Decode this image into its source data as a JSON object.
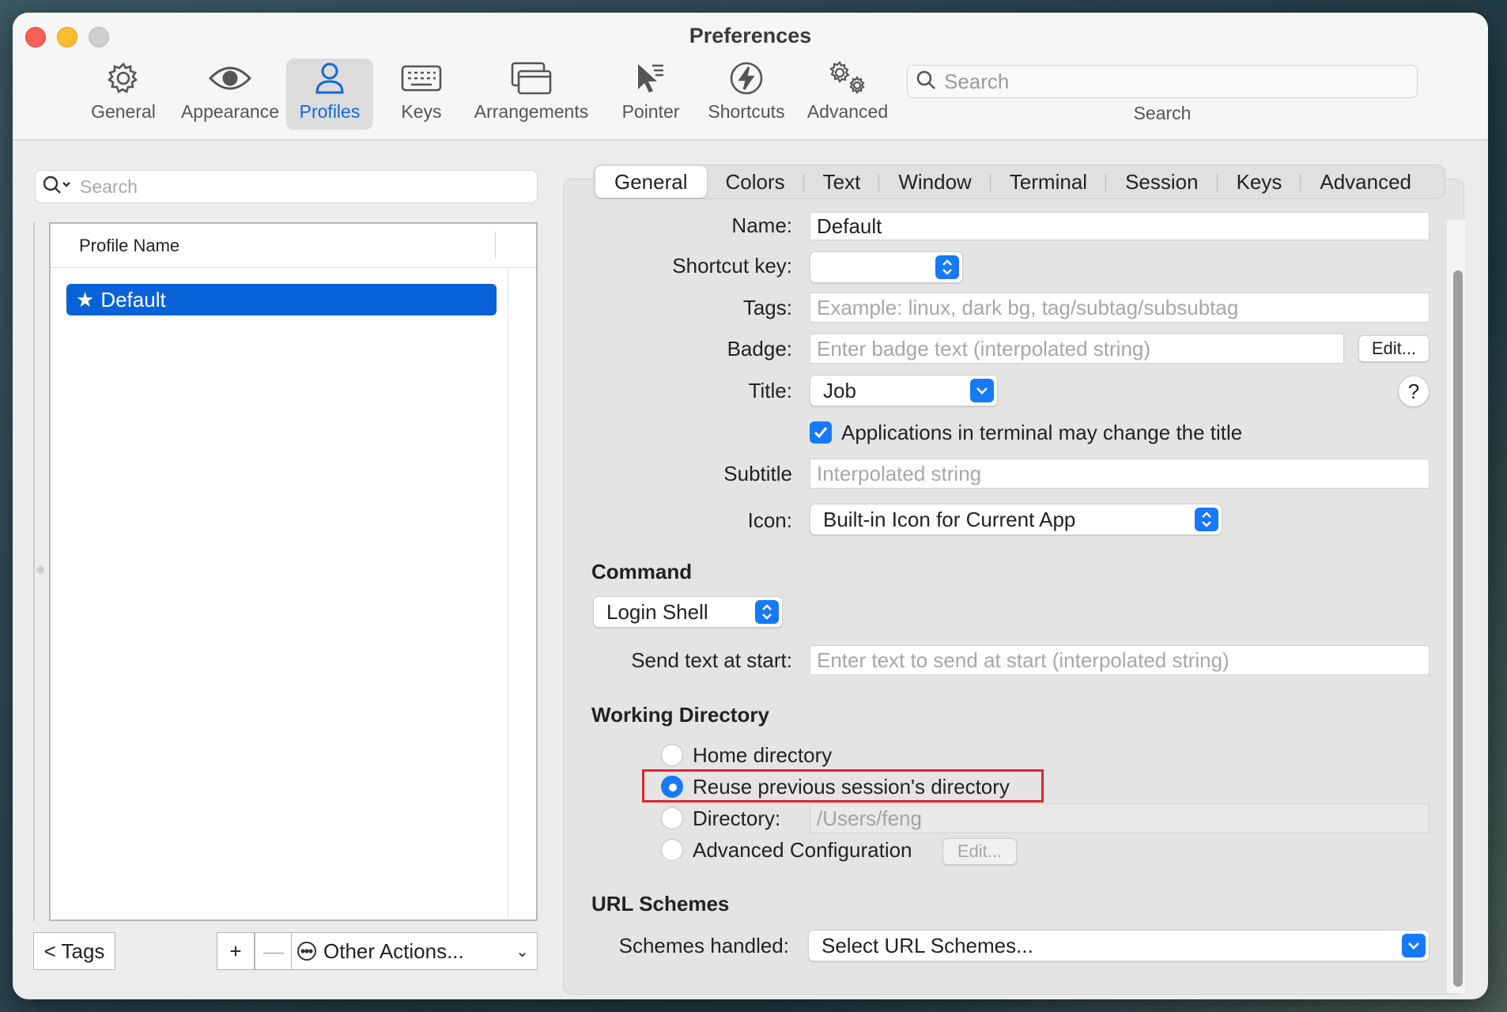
{
  "window": {
    "title": "Preferences"
  },
  "toolbar": {
    "items": [
      {
        "label": "General",
        "icon": "gear-icon"
      },
      {
        "label": "Appearance",
        "icon": "eye-icon"
      },
      {
        "label": "Profiles",
        "icon": "person-icon",
        "active": true
      },
      {
        "label": "Keys",
        "icon": "keyboard-icon"
      },
      {
        "label": "Arrangements",
        "icon": "windows-icon"
      },
      {
        "label": "Pointer",
        "icon": "cursor-icon"
      },
      {
        "label": "Shortcuts",
        "icon": "lightning-icon"
      },
      {
        "label": "Advanced",
        "icon": "gears-icon"
      }
    ],
    "search_placeholder": "Search",
    "search_label": "Search"
  },
  "profiles": {
    "search_placeholder": "Search",
    "column_header": "Profile Name",
    "items": [
      {
        "name": "Default",
        "is_default": true,
        "selected": true
      }
    ],
    "tags_button": "< Tags",
    "add_button": "+",
    "remove_button": "—",
    "other_actions": "Other Actions..."
  },
  "tabs": [
    "General",
    "Colors",
    "Text",
    "Window",
    "Terminal",
    "Session",
    "Keys",
    "Advanced"
  ],
  "general": {
    "name_label": "Name:",
    "name_value": "Default",
    "shortcut_label": "Shortcut key:",
    "shortcut_value": "",
    "tags_label": "Tags:",
    "tags_placeholder": "Example: linux, dark bg, tag/subtag/subsubtag",
    "badge_label": "Badge:",
    "badge_placeholder": "Enter badge text (interpolated string)",
    "badge_edit": "Edit...",
    "title_label": "Title:",
    "title_value": "Job",
    "help": "?",
    "apps_change_title": "Applications in terminal may change the title",
    "apps_change_title_checked": true,
    "subtitle_label": "Subtitle",
    "subtitle_placeholder": "Interpolated string",
    "icon_label": "Icon:",
    "icon_value": "Built-in Icon for Current App"
  },
  "command": {
    "section": "Command",
    "shell_value": "Login Shell",
    "send_text_label": "Send text at start:",
    "send_text_placeholder": "Enter text to send at start (interpolated string)"
  },
  "working_directory": {
    "section": "Working Directory",
    "options": {
      "home": "Home directory",
      "reuse": "Reuse previous session's directory",
      "directory": "Directory:",
      "advanced": "Advanced Configuration"
    },
    "selected": "reuse",
    "directory_value": "/Users/feng",
    "advanced_edit": "Edit..."
  },
  "url_schemes": {
    "section": "URL Schemes",
    "label": "Schemes handled:",
    "value": "Select URL Schemes..."
  },
  "colors": {
    "accent": "#1679f7",
    "selection": "#0a62d9",
    "highlight_box": "#e0262d"
  }
}
